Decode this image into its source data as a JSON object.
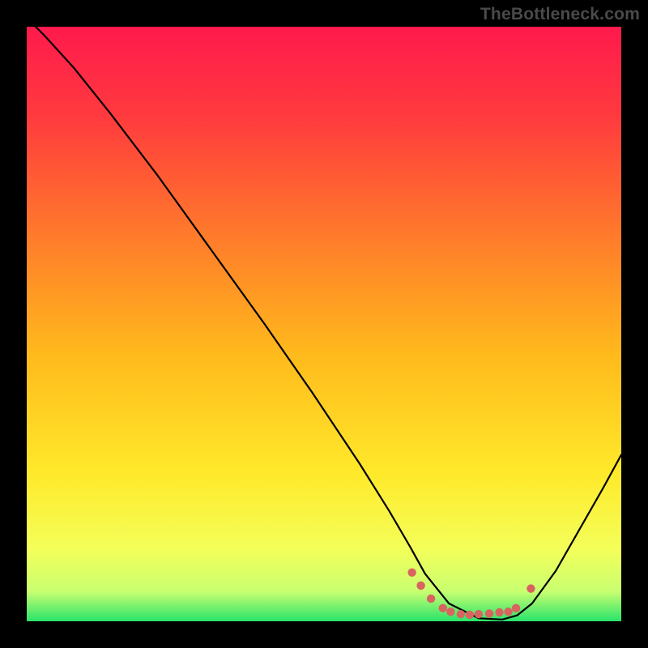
{
  "watermark": "TheBottleneck.com",
  "chart_data": {
    "type": "line",
    "title": "",
    "xlabel": "",
    "ylabel": "",
    "xlim": [
      0,
      100
    ],
    "ylim": [
      0,
      100
    ],
    "background_gradient": {
      "stops": [
        {
          "offset": 0.0,
          "color": "#ff1a4d"
        },
        {
          "offset": 0.15,
          "color": "#ff3a3e"
        },
        {
          "offset": 0.35,
          "color": "#ff7a2b"
        },
        {
          "offset": 0.55,
          "color": "#ffb91c"
        },
        {
          "offset": 0.75,
          "color": "#ffe92a"
        },
        {
          "offset": 0.88,
          "color": "#f3ff5a"
        },
        {
          "offset": 0.95,
          "color": "#c8ff70"
        },
        {
          "offset": 1.0,
          "color": "#29e36b"
        }
      ]
    },
    "series": [
      {
        "name": "bottleneck-curve",
        "color": "#000000",
        "stroke_width": 2.2,
        "x": [
          0.0,
          3.0,
          8.0,
          14.0,
          22.0,
          31.0,
          40.0,
          48.0,
          56.0,
          61.0,
          64.5,
          67.0,
          71.0,
          76.0,
          80.0,
          82.5,
          85.0,
          89.0,
          93.0,
          97.0,
          100.0
        ],
        "y": [
          101.5,
          98.5,
          93.0,
          85.5,
          75.0,
          62.5,
          50.0,
          38.5,
          26.5,
          18.5,
          12.5,
          8.0,
          3.0,
          0.5,
          0.3,
          1.0,
          3.0,
          8.5,
          15.5,
          22.5,
          28.0
        ]
      }
    ],
    "markers": {
      "name": "fit-range-dots",
      "color": "#d9635f",
      "radius": 5.2,
      "points": [
        {
          "x": 64.8,
          "y": 8.2
        },
        {
          "x": 66.3,
          "y": 6.0
        },
        {
          "x": 68.0,
          "y": 3.8
        },
        {
          "x": 70.0,
          "y": 2.2
        },
        {
          "x": 71.3,
          "y": 1.6
        },
        {
          "x": 73.0,
          "y": 1.2
        },
        {
          "x": 74.5,
          "y": 1.1
        },
        {
          "x": 76.0,
          "y": 1.2
        },
        {
          "x": 77.8,
          "y": 1.3
        },
        {
          "x": 79.5,
          "y": 1.5
        },
        {
          "x": 81.0,
          "y": 1.6
        },
        {
          "x": 82.3,
          "y": 2.2
        },
        {
          "x": 84.8,
          "y": 5.5
        }
      ]
    }
  }
}
